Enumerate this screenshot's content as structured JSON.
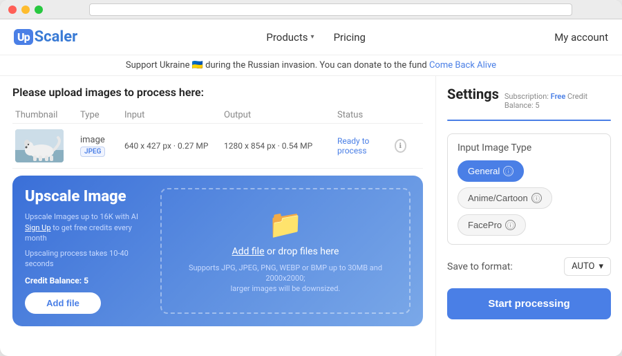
{
  "window": {
    "titlebar": {
      "btn_close": "close",
      "btn_min": "minimize",
      "btn_max": "maximize"
    }
  },
  "navbar": {
    "logo_up": "Up",
    "logo_scaler": "Scaler",
    "nav_products": "Products",
    "nav_pricing": "Pricing",
    "nav_account": "My account"
  },
  "banner": {
    "text": "Support Ukraine 🇺🇦 during the Russian invasion. You can donate to the fund ",
    "link_text": "Come Back Alive",
    "link_url": "#"
  },
  "main_title": "Please upload images to process here:",
  "table": {
    "headers": [
      "Thumbnail",
      "Type",
      "Input",
      "Output",
      "Status"
    ],
    "rows": [
      {
        "type": "image",
        "badge": "JPEG",
        "input": "640 x 427 px · 0.27 MP",
        "output": "1280 x 854 px · 0.54 MP",
        "status": "Ready to process"
      }
    ]
  },
  "upload": {
    "title": "Upscale Image",
    "desc1": "Upscale Images up to 16K with AI",
    "link_text": "Sign Up",
    "desc2": " to get free credits every month",
    "desc3": "Upscaling process takes 10-40 seconds",
    "credit_label": "Credit Balance: 5",
    "add_file_btn": "Add file",
    "dropzone_text1": "Add file",
    "dropzone_text2": " or drop files here",
    "dropzone_hint": "Supports JPG, JPEG, PNG, WEBP or BMP up to 30MB and 2000x2000;\nlarger images will be downsized."
  },
  "settings": {
    "title": "Settings",
    "subscription_label": "Subscription:",
    "subscription_type": "Free",
    "credit_label": "Credit Balance:",
    "credit_value": "5",
    "input_image_type_label": "Input Image Type",
    "type_buttons": [
      {
        "label": "General",
        "active": true
      },
      {
        "label": "Anime/Cartoon",
        "active": false
      },
      {
        "label": "FacePro",
        "active": false
      }
    ],
    "save_format_label": "Save to format:",
    "save_format_value": "AUTO",
    "start_btn": "Start processing"
  }
}
